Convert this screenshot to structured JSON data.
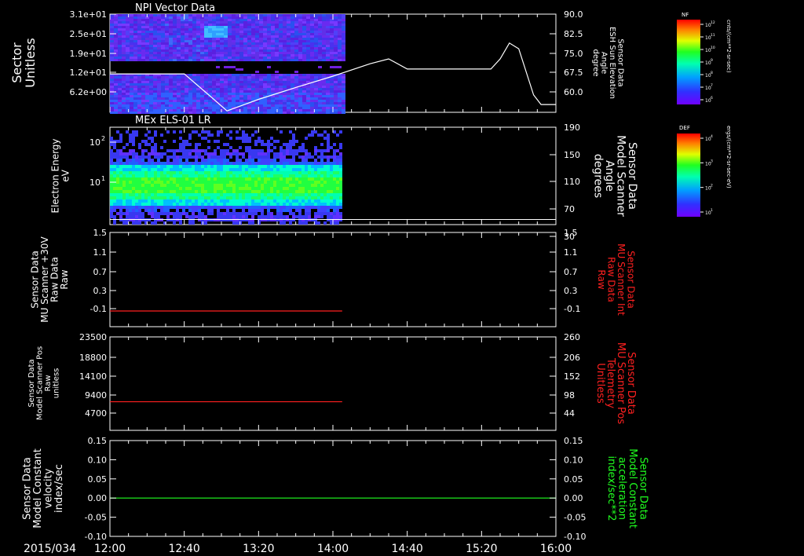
{
  "footer": {
    "date": "2015/034"
  },
  "x_axis": {
    "ticks": [
      "12:00",
      "12:40",
      "13:20",
      "14:00",
      "14:40",
      "15:20",
      "16:00"
    ]
  },
  "colorbars": [
    {
      "label": "NF",
      "unit": "cnts/(cm**2-sr-sec)",
      "tick_labels": [
        "10^12",
        "10^11",
        "10^10",
        "10^9",
        "10^8",
        "10^7",
        "10^6"
      ],
      "exponents": [
        "12",
        "11",
        "10",
        "9",
        "8",
        "7",
        "6"
      ]
    },
    {
      "label": "DEF",
      "unit": "ergs/(cm**2-sr-sec-eV)",
      "tick_labels": [
        "10^4",
        "10^3",
        "10^2",
        "10^1"
      ],
      "exponents": [
        "4",
        "3",
        "2",
        "1"
      ]
    }
  ],
  "panels": [
    {
      "title": "NPI Vector Data",
      "left_label": [
        "Sector",
        "Unitless"
      ],
      "left_ticks": [
        "3.1e+01",
        "2.5e+01",
        "1.9e+01",
        "1.2e+01",
        "6.2e+00"
      ],
      "right_label": [
        "Sensor Data",
        "ESH Sun Elevation",
        "Angle",
        "degree"
      ],
      "right_ticks": [
        "90.0",
        "82.5",
        "75.0",
        "67.5",
        "60.0"
      ]
    },
    {
      "title": "MEx ELS-01 LR",
      "left_label": [
        "Electron Energy",
        "eV"
      ],
      "left_ticks": [
        "10^2",
        "10^1"
      ],
      "right_label": [
        "Sensor Data",
        "Model Scanner",
        "Angle",
        "degrees"
      ],
      "right_ticks": [
        "190",
        "150",
        "110",
        "70",
        "30"
      ]
    },
    {
      "title": "",
      "left_label": [
        "Sensor Data",
        "MU Scanner +30V",
        "Raw Data",
        "Raw"
      ],
      "left_ticks": [
        "1.5",
        "1.1",
        "0.7",
        "0.3",
        "-0.1"
      ],
      "right_label": [
        "Sensor Data",
        "MU Scanner Int",
        "Raw Data",
        "Raw"
      ],
      "right_ticks": [
        "1.5",
        "1.1",
        "0.7",
        "0.3",
        "-0.1"
      ]
    },
    {
      "title": "",
      "left_label": [
        "Sensor Data",
        "Model Scanner Pos",
        "Raw",
        "unitless"
      ],
      "left_ticks": [
        "23500",
        "18800",
        "14100",
        "9400",
        "4700"
      ],
      "right_label": [
        "Sensor Data",
        "MU Scanner Pos",
        "Telemetry",
        "Unitless"
      ],
      "right_ticks": [
        "260",
        "206",
        "152",
        "98",
        "44"
      ]
    },
    {
      "title": "",
      "left_label": [
        "Sensor Data",
        "Model Constant",
        "velocity",
        "index/sec"
      ],
      "left_ticks": [
        "0.15",
        "0.10",
        "0.05",
        "0.00",
        "-0.05",
        "-0.10"
      ],
      "right_label": [
        "Sensor Data",
        "Model Constant",
        "acceleration",
        "index/sec**2"
      ],
      "right_ticks": [
        "0.15",
        "0.10",
        "0.05",
        "0.00",
        "-0.05",
        "-0.10"
      ]
    }
  ],
  "chart_data": [
    {
      "type": "heatmap",
      "title": "NPI Vector Data",
      "xlabel": "",
      "ylabel": "Sector Unitless",
      "x_range": [
        "12:00",
        "16:00"
      ],
      "data_end": "14:05",
      "y_range": [
        0,
        31
      ],
      "colorbar": "NF",
      "note_series": {
        "name": "Sensor Data ESH Sun Elevation Angle",
        "type": "line",
        "color": "#ffffff",
        "ylim": [
          56,
          90
        ],
        "x": [
          "12:00",
          "12:40",
          "12:55",
          "13:03",
          "13:20",
          "13:40",
          "14:00",
          "14:20",
          "14:30",
          "14:40",
          "15:00",
          "15:20",
          "15:25",
          "15:30",
          "15:35",
          "15:40",
          "15:48",
          "15:52",
          "16:00"
        ],
        "y": [
          69.3,
          69.3,
          61,
          56.5,
          60.5,
          64.6,
          68.5,
          72.8,
          74.5,
          71,
          71,
          71,
          71,
          74.5,
          80,
          78,
          62,
          58.7,
          58.7
        ]
      }
    },
    {
      "type": "heatmap",
      "title": "MEx ELS-01 LR",
      "ylabel": "Electron Energy eV",
      "yscale": "log",
      "ylim": [
        1.5,
        150
      ],
      "x_range": [
        "12:00",
        "16:00"
      ],
      "data_end": "14:05",
      "colorbar": "DEF",
      "note_series": {
        "name": "Sensor Data Model Scanner Angle",
        "type": "line",
        "color": "#ffffff",
        "ylim": [
          0,
          190
        ],
        "x": [
          "12:00",
          "16:00"
        ],
        "y": [
          10,
          10
        ]
      }
    },
    {
      "type": "line",
      "ylabel": "Sensor Data MU Scanner +30V Raw Data Raw",
      "ylim": [
        -0.3,
        1.5
      ],
      "series": [
        {
          "name": "Sensor Data MU Scanner +30V Raw Data",
          "color": "#ff2020",
          "x": [
            "12:00",
            "14:05"
          ],
          "y": [
            0,
            0
          ]
        }
      ]
    },
    {
      "type": "line",
      "ylabel": "Sensor Data Model Scanner Pos Raw unitless",
      "ylim": [
        0,
        23500
      ],
      "series": [
        {
          "name": "Sensor Data Model Scanner Pos Raw",
          "color": "#ff2020",
          "x": [
            "12:00",
            "14:05"
          ],
          "y": [
            7200,
            7200
          ]
        }
      ]
    },
    {
      "type": "line",
      "ylabel": "Sensor Data Model Constant velocity index/sec",
      "ylim": [
        -0.1,
        0.15
      ],
      "series": [
        {
          "name": "Sensor Data Model Constant velocity",
          "color": "#20ff20",
          "x": [
            "12:00",
            "16:00"
          ],
          "y": [
            0,
            0
          ]
        }
      ]
    }
  ]
}
